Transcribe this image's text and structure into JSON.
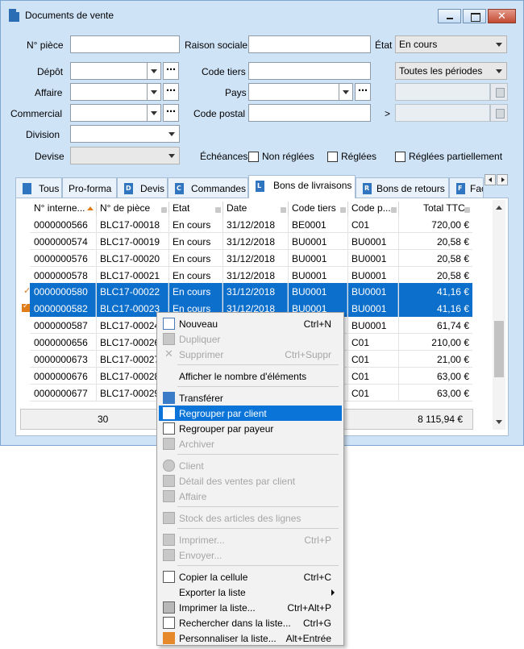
{
  "window": {
    "title": "Documents de vente",
    "close_glyph": "✕"
  },
  "form": {
    "no_piece_label": "N° pièce",
    "depot_label": "Dépôt",
    "affaire_label": "Affaire",
    "commercial_label": "Commercial",
    "division_label": "Division",
    "devise_label": "Devise",
    "raison_sociale_label": "Raison sociale",
    "code_tiers_label": "Code tiers",
    "pays_label": "Pays",
    "code_postal_label": "Code postal",
    "etat_label": "État",
    "etat_value": "En cours",
    "periode_value": "Toutes les périodes",
    "range_separator": ">",
    "echeances_label": "Échéances",
    "non_reglees_label": "Non réglées",
    "reglees_label": "Réglées",
    "reglees_partiellement_label": "Réglées partiellement",
    "dots_glyph": "⋯"
  },
  "tabs": [
    {
      "label": "Tous",
      "icon_letter": ""
    },
    {
      "label": "Pro-forma",
      "icon_letter": ""
    },
    {
      "label": "Devis",
      "icon_letter": "D"
    },
    {
      "label": "Commandes",
      "icon_letter": "C"
    },
    {
      "label": "Bons de livraisons",
      "icon_letter": "L"
    },
    {
      "label": "Bons de retours",
      "icon_letter": "R"
    },
    {
      "label": "Fac",
      "icon_letter": "F"
    }
  ],
  "grid": {
    "columns": [
      "N° interne...",
      "N° de pièce",
      "Etat",
      "Date",
      "Code tiers",
      "Code p...",
      "Total TTC"
    ],
    "rows": [
      {
        "interne": "0000000566",
        "piece": "BLC17-00018",
        "etat": "En cours",
        "date": "31/12/2018",
        "tiers": "BE0001",
        "codep": "C01",
        "total": "720,00 €"
      },
      {
        "interne": "0000000574",
        "piece": "BLC17-00019",
        "etat": "En cours",
        "date": "31/12/2018",
        "tiers": "BU0001",
        "codep": "BU0001",
        "total": "20,58 €"
      },
      {
        "interne": "0000000576",
        "piece": "BLC17-00020",
        "etat": "En cours",
        "date": "31/12/2018",
        "tiers": "BU0001",
        "codep": "BU0001",
        "total": "20,58 €"
      },
      {
        "interne": "0000000578",
        "piece": "BLC17-00021",
        "etat": "En cours",
        "date": "31/12/2018",
        "tiers": "BU0001",
        "codep": "BU0001",
        "total": "20,58 €"
      },
      {
        "interne": "0000000580",
        "piece": "BLC17-00022",
        "etat": "En cours",
        "date": "31/12/2018",
        "tiers": "BU0001",
        "codep": "BU0001",
        "total": "41,16 €"
      },
      {
        "interne": "0000000582",
        "piece": "BLC17-00023",
        "etat": "En cours",
        "date": "31/12/2018",
        "tiers": "BU0001",
        "codep": "BU0001",
        "total": "41,16 €"
      },
      {
        "interne": "0000000587",
        "piece": "BLC17-00024",
        "codep": "BU0001",
        "total": "61,74 €"
      },
      {
        "interne": "0000000656",
        "piece": "BLC17-00026",
        "codep": "C01",
        "total": "210,00 €"
      },
      {
        "interne": "0000000673",
        "piece": "BLC17-00027",
        "codep": "C01",
        "total": "21,00 €"
      },
      {
        "interne": "0000000676",
        "piece": "BLC17-00028",
        "codep": "C01",
        "total": "63,00 €"
      },
      {
        "interne": "0000000677",
        "piece": "BLC17-00029",
        "codep": "C01",
        "total": "63,00 €"
      }
    ],
    "footer_count": "30",
    "footer_total": "8 115,94 €"
  },
  "menu": {
    "nouveau": {
      "label": "Nouveau",
      "shortcut": "Ctrl+N"
    },
    "dupliquer": {
      "label": "Dupliquer"
    },
    "supprimer": {
      "label": "Supprimer",
      "shortcut": "Ctrl+Suppr"
    },
    "afficher_nombre": {
      "label": "Afficher le nombre d'éléments"
    },
    "transferer": {
      "label": "Transférer"
    },
    "regrouper_client": {
      "label": "Regrouper par client"
    },
    "regrouper_payeur": {
      "label": "Regrouper par payeur"
    },
    "archiver": {
      "label": "Archiver"
    },
    "client": {
      "label": "Client"
    },
    "detail_ventes": {
      "label": "Détail des ventes par client"
    },
    "affaire": {
      "label": "Affaire"
    },
    "stock_articles": {
      "label": "Stock des articles des lignes"
    },
    "imprimer": {
      "label": "Imprimer...",
      "shortcut": "Ctrl+P"
    },
    "envoyer": {
      "label": "Envoyer..."
    },
    "copier_cellule": {
      "label": "Copier la cellule",
      "shortcut": "Ctrl+C"
    },
    "exporter_liste": {
      "label": "Exporter la liste"
    },
    "imprimer_liste": {
      "label": "Imprimer la liste...",
      "shortcut": "Ctrl+Alt+P"
    },
    "rechercher_liste": {
      "label": "Rechercher dans la liste...",
      "shortcut": "Ctrl+G"
    },
    "personnaliser_liste": {
      "label": "Personnaliser la liste...",
      "shortcut": "Alt+Entrée"
    }
  },
  "colors": {
    "window_bg": "#cfe3f7",
    "selection": "#0d6fcc",
    "menu_highlight": "#0a74d8",
    "accent_orange": "#e07c1a"
  }
}
